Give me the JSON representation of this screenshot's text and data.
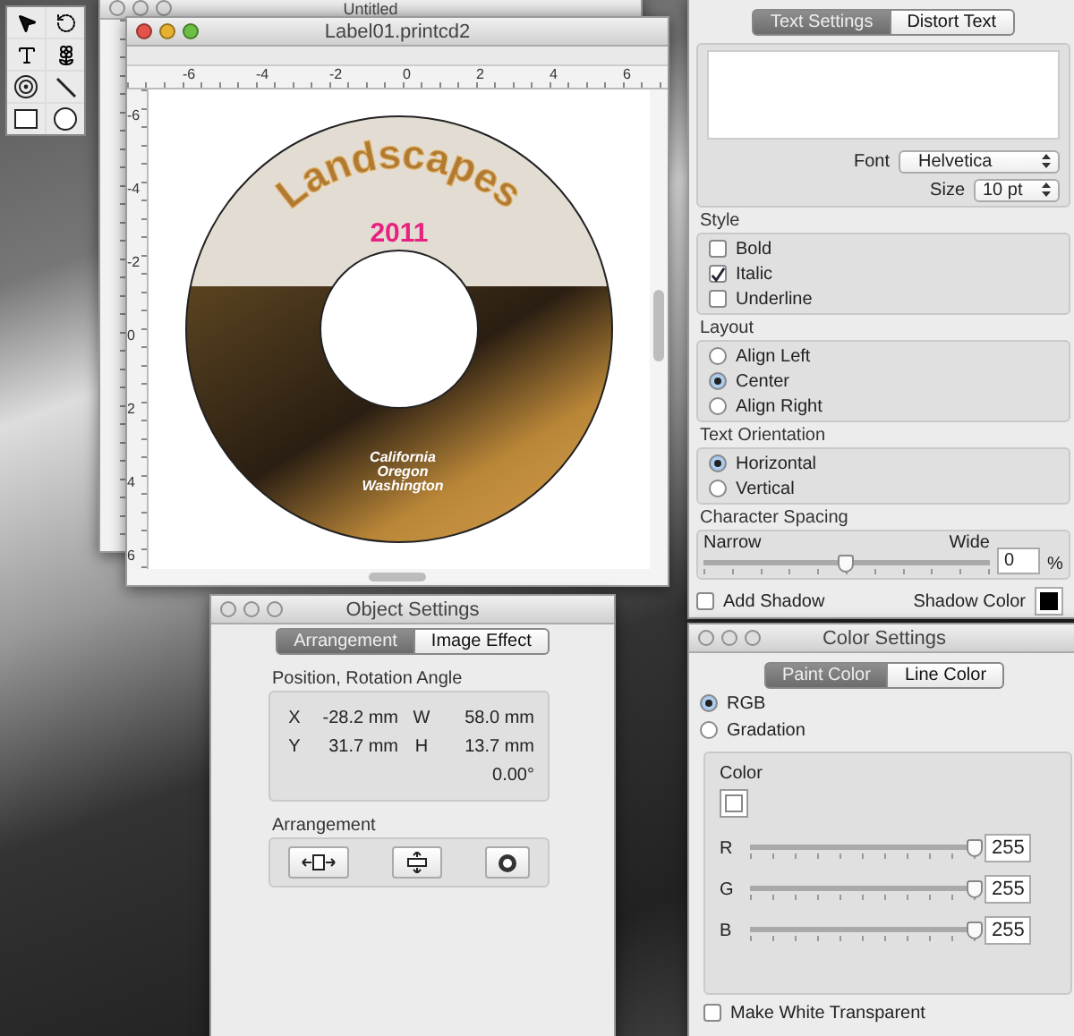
{
  "back_window": {
    "title": "Untitled"
  },
  "document_window": {
    "title": "Label01.printcd2",
    "ruler_h": [
      "-6",
      "-4",
      "-2",
      "0",
      "2",
      "4",
      "6"
    ],
    "ruler_v": [
      "-6",
      "-4",
      "-2",
      "0",
      "2",
      "4",
      "6"
    ],
    "disc": {
      "title": "Landscapes",
      "year": "2011",
      "lines": [
        "California",
        "Oregon",
        "Washington"
      ]
    }
  },
  "text_settings": {
    "tabs": [
      {
        "label": "Text Settings",
        "selected": true
      },
      {
        "label": "Distort Text",
        "selected": false
      }
    ],
    "font": {
      "label": "Font",
      "value": "Helvetica"
    },
    "size": {
      "label": "Size",
      "value": "10 pt"
    },
    "style": {
      "title": "Style",
      "options": [
        {
          "label": "Bold",
          "checked": false
        },
        {
          "label": "Italic",
          "checked": true
        },
        {
          "label": "Underline",
          "checked": false
        }
      ]
    },
    "layout": {
      "title": "Layout",
      "options": [
        {
          "label": "Align Left",
          "selected": false
        },
        {
          "label": "Center",
          "selected": true
        },
        {
          "label": "Align Right",
          "selected": false
        }
      ]
    },
    "orientation": {
      "title": "Text Orientation",
      "options": [
        {
          "label": "Horizontal",
          "selected": true
        },
        {
          "label": "Vertical",
          "selected": false
        }
      ]
    },
    "spacing": {
      "title": "Character Spacing",
      "min_label": "Narrow",
      "max_label": "Wide",
      "level": 0.5,
      "value": "0",
      "unit": "%"
    },
    "shadow": {
      "label": "Add Shadow",
      "checked": false,
      "color_label": "Shadow Color",
      "color": "#000000"
    }
  },
  "object_settings": {
    "title": "Object Settings",
    "tabs": [
      {
        "label": "Arrangement",
        "selected": true
      },
      {
        "label": "Image Effect",
        "selected": false
      }
    ],
    "position": {
      "title": "Position, Rotation Angle",
      "fields": [
        {
          "label": "X",
          "value": "-28.2 mm"
        },
        {
          "label": "W",
          "value": "58.0 mm"
        },
        {
          "label": "Y",
          "value": "31.7 mm"
        },
        {
          "label": "H",
          "value": "13.7 mm"
        }
      ],
      "rotation": "0.00°"
    },
    "arrangement": {
      "title": "Arrangement",
      "buttons": [
        {
          "kind": "horizontal"
        },
        {
          "kind": "vertical"
        },
        {
          "kind": "center"
        }
      ]
    }
  },
  "color_settings": {
    "title": "Color Settings",
    "tabs": [
      {
        "label": "Paint Color",
        "selected": true
      },
      {
        "label": "Line Color",
        "selected": false
      }
    ],
    "modes": [
      {
        "label": "RGB",
        "selected": true
      },
      {
        "label": "Gradation",
        "selected": false
      }
    ],
    "color_label": "Color",
    "channels": [
      {
        "label": "R",
        "level": 1,
        "value": "255"
      },
      {
        "label": "G",
        "level": 1,
        "value": "255"
      },
      {
        "label": "B",
        "level": 1,
        "value": "255"
      }
    ],
    "transparent": {
      "label": "Make White Transparent",
      "checked": false
    }
  }
}
